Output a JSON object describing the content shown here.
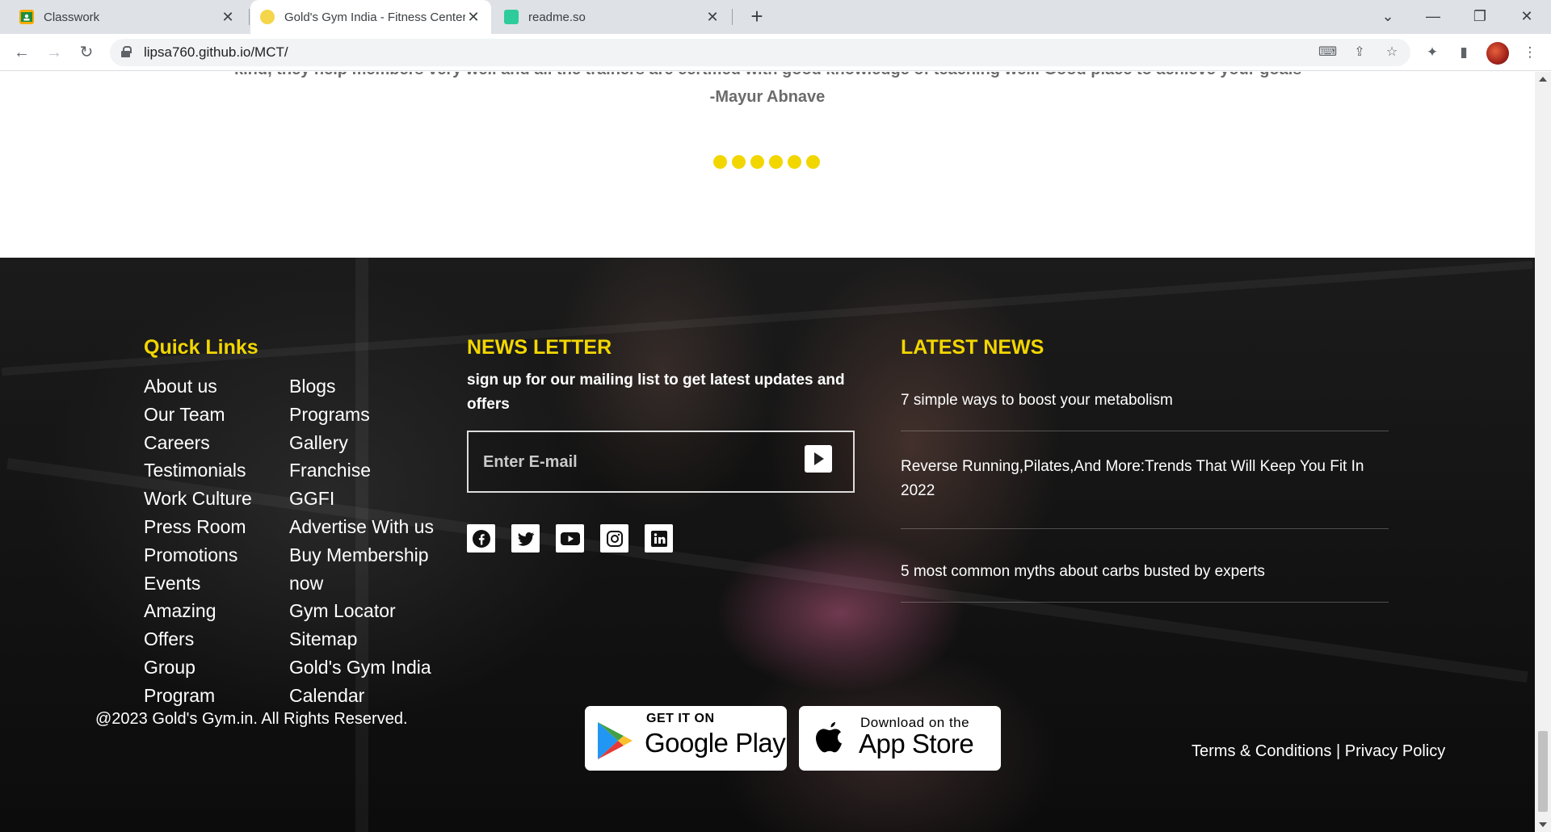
{
  "browser": {
    "tabs": [
      {
        "title": "Classwork",
        "active": false,
        "icon": "classroom-icon"
      },
      {
        "title": "Gold's Gym India - Fitness Center",
        "active": true,
        "icon": "gym-favicon-icon"
      },
      {
        "title": "readme.so",
        "active": false,
        "icon": "readme-icon"
      }
    ],
    "url": "lipsa760.github.io/MCT/"
  },
  "testimonial": {
    "cut_text": "kind, they help members very well and all the trainers are certified with good knowledge of teaching well. Good place to achieve your goals.",
    "author": "-Mayur Abnave",
    "dots_count": 6,
    "dot_color": "#f2d600"
  },
  "footer": {
    "accent_color": "#f2d600",
    "quick_links": {
      "heading": "Quick Links",
      "col1": [
        "About us",
        "Our Team",
        "Careers",
        "Testimonials",
        "Work Culture",
        "Press Room",
        "Promotions",
        "Events",
        "Amazing",
        "Offers",
        "Group",
        "Program"
      ],
      "col2": [
        "Blogs",
        "Programs",
        "Gallery",
        "Franchise",
        "GGFI",
        "Advertise With us",
        "Buy Membership",
        "now",
        "Gym Locator",
        "Sitemap",
        "Gold's Gym India",
        "Calendar"
      ]
    },
    "newsletter": {
      "heading": "NEWS LETTER",
      "text": "sign up for our mailing list to get latest updates and offers",
      "placeholder": "Enter E-mail",
      "socials": [
        "facebook-icon",
        "twitter-icon",
        "youtube-icon",
        "instagram-icon",
        "linkedin-icon"
      ]
    },
    "latest_news": {
      "heading": "LATEST NEWS",
      "items": [
        "7 simple ways to boost your metabolism",
        "Reverse Running,Pilates,And More:Trends That Will Keep You Fit In 2022",
        "5 most common myths about carbs busted by experts"
      ]
    },
    "copyright": "@2023 Gold's Gym.in. All Rights Reserved.",
    "google_play": {
      "small": "GET IT ON",
      "big": "Google Play"
    },
    "app_store": {
      "small": "Download on the",
      "big": "App Store"
    },
    "terms": "Terms & Conditions",
    "separator": "|",
    "privacy": "Privacy Policy"
  }
}
